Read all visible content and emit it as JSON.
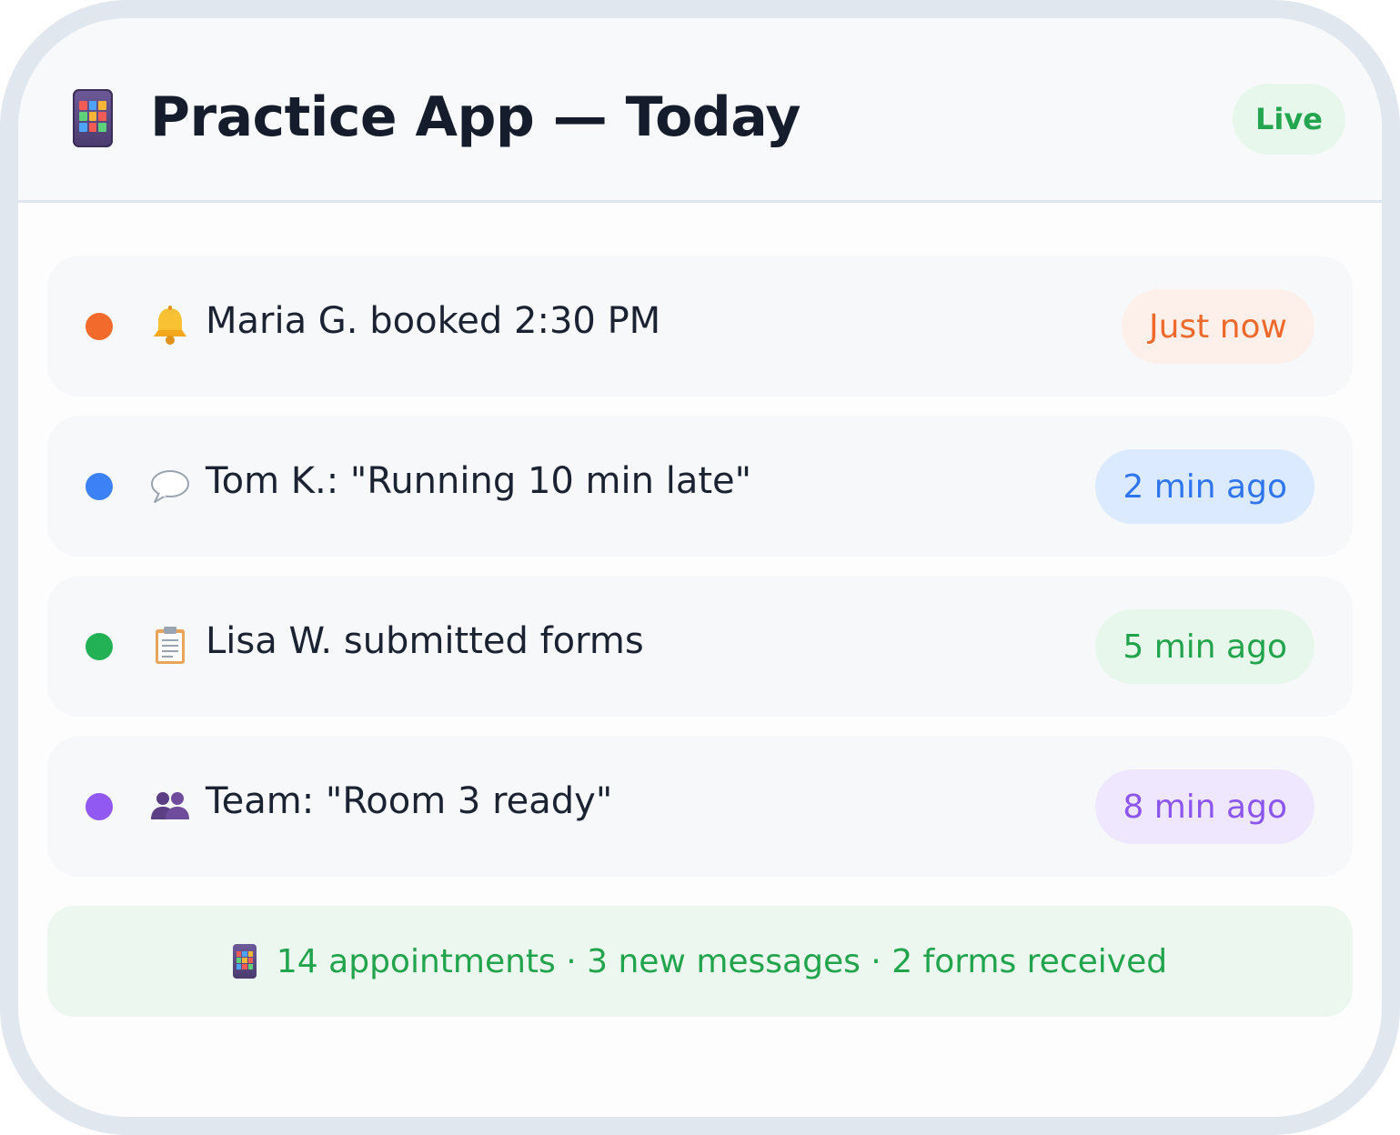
{
  "header": {
    "app_icon": "mobile-app-icon",
    "title": "Practice App — Today",
    "badge": "Live"
  },
  "feed": {
    "items": [
      {
        "dot_color": "#f26b2d",
        "icon": "bell-icon",
        "text": "Maria G. booked 2:30 PM",
        "time": "Just now",
        "pill_bg": "#fdf0ea",
        "pill_color": "#ee6a2c"
      },
      {
        "dot_color": "#3c82f6",
        "icon": "speech-bubble-icon",
        "text": "Tom K.: \"Running 10 min late\"",
        "time": "2 min ago",
        "pill_bg": "#dbeafe",
        "pill_color": "#2f76ee"
      },
      {
        "dot_color": "#22b154",
        "icon": "clipboard-icon",
        "text": "Lisa W. submitted forms",
        "time": "5 min ago",
        "pill_bg": "#e8f7ec",
        "pill_color": "#22a44c"
      },
      {
        "dot_color": "#9258f2",
        "icon": "team-icon",
        "text": "Team: \"Room 3 ready\"",
        "time": "8 min ago",
        "pill_bg": "#efe7fd",
        "pill_color": "#8b55ee"
      }
    ]
  },
  "summary": {
    "icon": "mobile-app-icon",
    "text": "14 appointments · 3 new messages · 2 forms received"
  },
  "colors": {
    "accent_green": "#22a44c",
    "title": "#151c2b",
    "frame": "#e1e7ef"
  }
}
